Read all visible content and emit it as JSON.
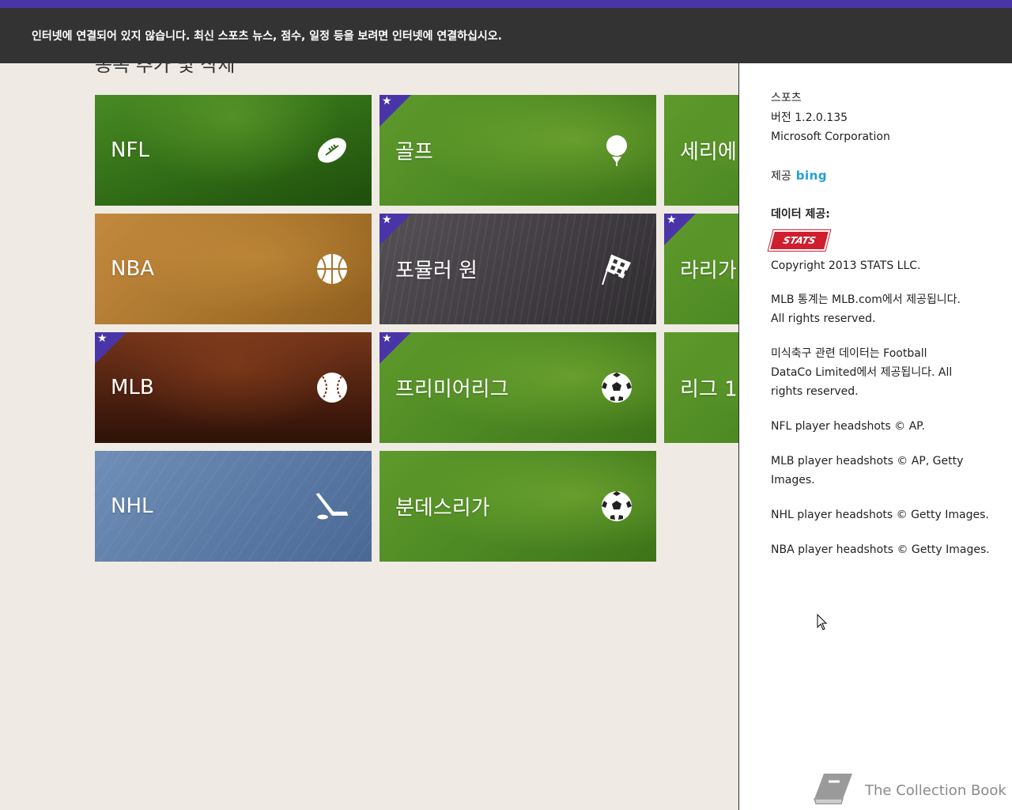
{
  "banner": {
    "text": "인터넷에 연결되어 있지 않습니다. 최신 스포츠 뉴스, 점수, 일정 등을 보려면 인터넷에 연결하십시오."
  },
  "main": {
    "heading": "종목 추가 및 삭제",
    "tiles": [
      {
        "label": "NFL",
        "icon": "football-icon",
        "favorite": false
      },
      {
        "label": "골프",
        "icon": "golf-ball-icon",
        "favorite": true
      },
      {
        "label": "세리에",
        "icon": "",
        "favorite": false
      },
      {
        "label": "NBA",
        "icon": "basketball-icon",
        "favorite": false
      },
      {
        "label": "포뮬러 원",
        "icon": "checkered-flag-icon",
        "favorite": true
      },
      {
        "label": "라리가",
        "icon": "",
        "favorite": true
      },
      {
        "label": "MLB",
        "icon": "baseball-icon",
        "favorite": true
      },
      {
        "label": "프리미어리그",
        "icon": "soccer-ball-icon",
        "favorite": true
      },
      {
        "label": "리그 1",
        "icon": "",
        "favorite": false
      },
      {
        "label": "NHL",
        "icon": "hockey-stick-icon",
        "favorite": false
      },
      {
        "label": "분데스리가",
        "icon": "soccer-ball-icon",
        "favorite": false
      }
    ]
  },
  "about": {
    "app_name": "스포츠",
    "version": "버전 1.2.0.135",
    "publisher": "Microsoft Corporation",
    "provided_by": "제공",
    "provider_logo": "bing",
    "data_provided_heading": "데이터 제공:",
    "stats_logo": "STATS",
    "stats_copyright": "Copyright 2013 STATS LLC.",
    "mlb_line1": "MLB 통계는 MLB.com에서 제공됩니다.",
    "mlb_line2": "All rights reserved.",
    "football_line1": "미식축구 관련 데이터는 Football",
    "football_line2": "DataCo Limited에서 제공됩니다. All",
    "football_line3": "rights reserved.",
    "nfl_headshots": "NFL player headshots © AP.",
    "mlb_headshots_line1": "MLB player headshots © AP, Getty",
    "mlb_headshots_line2": "Images.",
    "nhl_headshots": "NHL player headshots © Getty Images.",
    "nba_headshots": "NBA player headshots © Getty Images."
  },
  "watermark": {
    "text": "The Collection Book"
  },
  "colors": {
    "accent": "#4a35a8",
    "banner_bg": "#333333",
    "page_bg": "#efebe4",
    "bing": "#1fa0d6",
    "stats_red": "#cf1f2f"
  }
}
